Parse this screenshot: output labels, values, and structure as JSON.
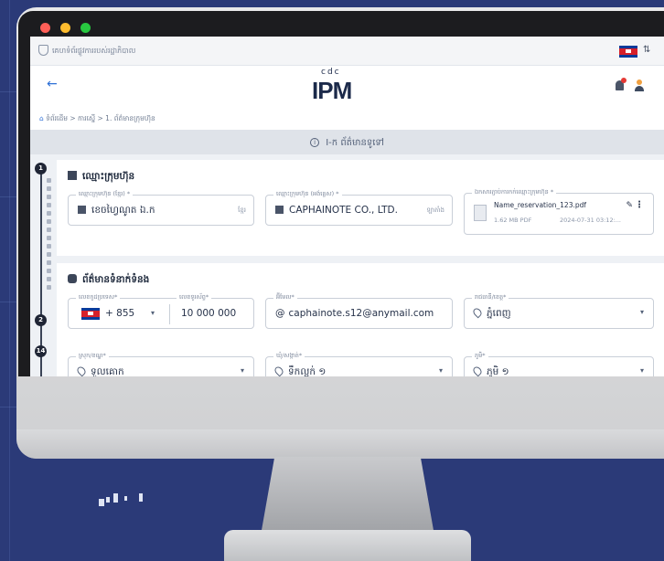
{
  "status_bar": {
    "text": "គេហទំព័រផ្លូវការរបស់រដ្ឋាភិបាល",
    "language_icon": "translate-icon"
  },
  "header": {
    "logo_top": "cdc",
    "logo_main": "IPM",
    "back_icon": "arrow-left-icon"
  },
  "breadcrumb": {
    "home": "ទំព័រដើម",
    "sep": ">",
    "level2": "ការស្នើ",
    "level3": "1. ព័ត៌មានក្រុមហ៊ុន"
  },
  "section_banner": "I-ក ព័ត៌មានទូទៅ",
  "stepper": {
    "steps": [
      "1",
      "2",
      "14"
    ]
  },
  "company_card": {
    "title": "ឈ្មោះក្រុមហ៊ុន",
    "fields": [
      {
        "label": "ឈ្មោះក្រុមហ៊ុន (ខ្មែរ) *",
        "value": "ខេចហ្វៃណូត ឯ.ក",
        "suffix": "ខ្មែរ"
      },
      {
        "label": "ឈ្មោះក្រុមហ៊ុន (អង់គ្លេស) *",
        "value": "CAPHAINOTE CO., LTD.",
        "suffix": "ឡាតាំង"
      }
    ],
    "file": {
      "label": "ឯកសារភ្ជាប់ការកក់ឈ្មោះក្រុមហ៊ុន *",
      "name": "Name_reservation_123.pdf",
      "size": "1.62 MB PDF",
      "date": "2024-07-31 03:12:..."
    }
  },
  "contact_card": {
    "title": "ព័ត៌មានទំនាក់ទំនង",
    "phone_code_label": "លេខកូដប្រទេស*",
    "phone_code": "+ 855",
    "phone_label": "លេខទូរស័ព្ទ*",
    "phone": "10 000 000",
    "email_label": "អ៊ីមែល*",
    "email": "caphainote.s12@anymail.com",
    "province_label": "រាជធានី/ខេត្ត*",
    "province": "ភ្នំពេញ",
    "district_label": "ស្រុក/ខណ្ឌ*",
    "district": "ទួលគោក",
    "commune_label": "ឃុំ/សង្កាត់*",
    "commune": "ទឹកល្អក់ ១",
    "village_label": "ភូមិ*",
    "village": "ភូមិ ១"
  },
  "colors": {
    "accent": "#2d6fd6",
    "background": "#2b3a78",
    "flag_blue": "#0a3a9a",
    "flag_red": "#d7202a"
  }
}
